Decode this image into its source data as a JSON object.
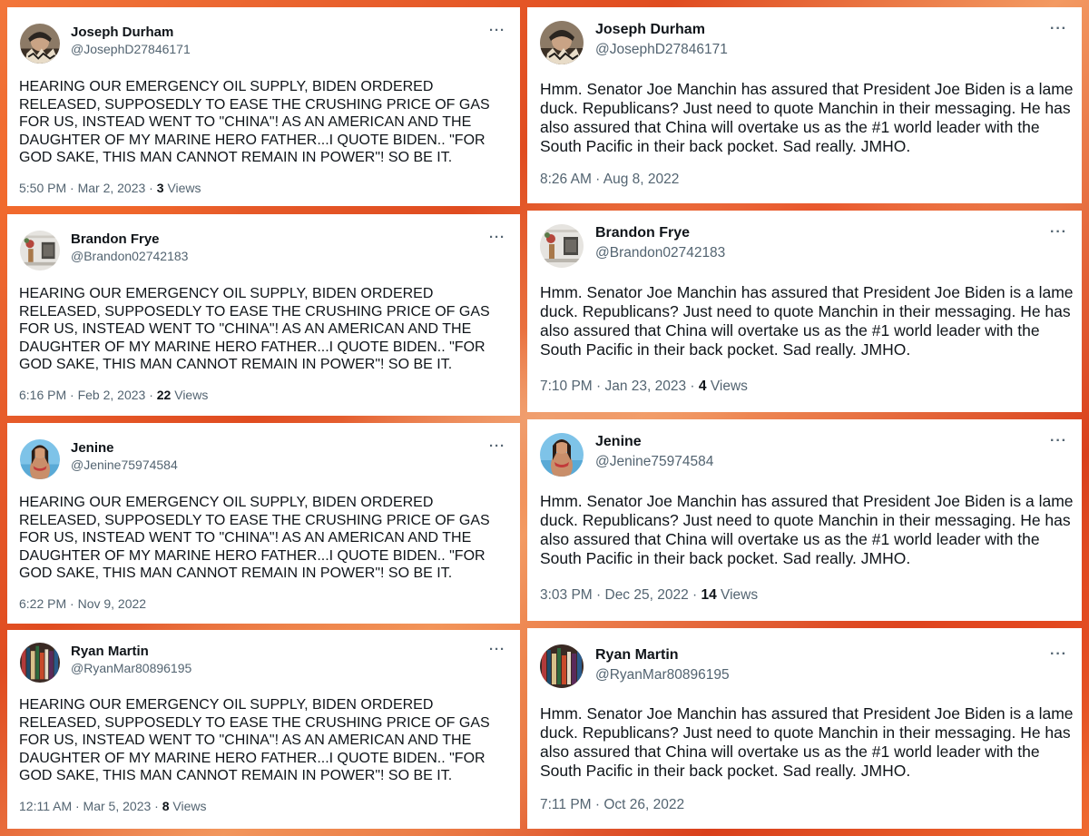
{
  "left_tweets": [
    {
      "name": "Joseph Durham",
      "handle": "@JosephD27846171",
      "text": "HEARING OUR EMERGENCY OIL SUPPLY, BIDEN ORDERED RELEASED, SUPPOSEDLY TO EASE THE CRUSHING PRICE OF GAS FOR US, INSTEAD WENT TO \"CHINA\"!  AS AN AMERICAN AND THE DAUGHTER OF MY MARINE HERO FATHER...I  QUOTE BIDEN.. \"FOR GOD SAKE, THIS MAN CANNOT REMAIN IN POWER\"! SO BE IT.",
      "timestamp": "5:50 PM · Mar 2, 2023",
      "views_count": "3",
      "views_label": "Views",
      "more": "···"
    },
    {
      "name": "Brandon Frye",
      "handle": "@Brandon02742183",
      "text": "HEARING OUR EMERGENCY OIL SUPPLY, BIDEN ORDERED RELEASED, SUPPOSEDLY TO EASE THE CRUSHING PRICE OF GAS FOR US, INSTEAD WENT TO \"CHINA\"!  AS AN AMERICAN AND THE DAUGHTER OF MY MARINE HERO FATHER...I  QUOTE BIDEN.. \"FOR GOD SAKE, THIS MAN CANNOT REMAIN IN POWER\"! SO BE IT.",
      "timestamp": "6:16 PM · Feb 2, 2023",
      "views_count": "22",
      "views_label": "Views",
      "more": "···"
    },
    {
      "name": "Jenine",
      "handle": "@Jenine75974584",
      "text": "HEARING OUR EMERGENCY OIL SUPPLY, BIDEN ORDERED RELEASED, SUPPOSEDLY TO EASE THE CRUSHING PRICE OF GAS FOR US, INSTEAD WENT TO \"CHINA\"!  AS AN AMERICAN AND THE DAUGHTER OF MY MARINE HERO FATHER...I  QUOTE BIDEN.. \"FOR GOD SAKE, THIS MAN CANNOT REMAIN IN POWER\"! SO BE IT.",
      "timestamp": "6:22 PM · Nov 9, 2022",
      "views_count": "",
      "views_label": "",
      "more": "···"
    },
    {
      "name": "Ryan Martin",
      "handle": "@RyanMar80896195",
      "text": "HEARING OUR EMERGENCY OIL SUPPLY, BIDEN ORDERED RELEASED, SUPPOSEDLY TO EASE THE CRUSHING PRICE OF GAS FOR US, INSTEAD WENT TO \"CHINA\"!  AS AN AMERICAN AND THE DAUGHTER OF MY MARINE HERO FATHER...I  QUOTE BIDEN.. \"FOR GOD SAKE, THIS MAN CANNOT REMAIN IN POWER\"! SO BE IT.",
      "timestamp": "12:11 AM · Mar 5, 2023",
      "views_count": "8",
      "views_label": "Views",
      "more": "···"
    }
  ],
  "right_tweets": [
    {
      "name": "Joseph Durham",
      "handle": "@JosephD27846171",
      "text": "Hmm. Senator Joe Manchin has assured that President Joe Biden is a lame duck. Republicans? Just need to quote Manchin in their messaging. He has also assured that China will overtake us as the #1 world leader with the South Pacific in their back pocket. Sad really. JMHO.",
      "timestamp": "8:26 AM · Aug 8, 2022",
      "views_count": "",
      "views_label": "",
      "more": "···"
    },
    {
      "name": "Brandon Frye",
      "handle": "@Brandon02742183",
      "text": "Hmm. Senator Joe Manchin has assured that President Joe Biden is a lame duck. Republicans? Just need to quote Manchin in their messaging. He has also assured that China will overtake us as the #1 world leader with the South Pacific in their back pocket. Sad really. JMHO.",
      "timestamp": "7:10 PM · Jan 23, 2023 · ",
      "views_count": "4",
      "views_label": "Views",
      "more": "···"
    },
    {
      "name": "Jenine",
      "handle": "@Jenine75974584",
      "text": "Hmm. Senator Joe Manchin has assured that President Joe Biden is a lame duck. Republicans? Just need to quote Manchin in their messaging. He has also assured that China will overtake us as the #1 world leader with the South Pacific in their back pocket. Sad really. JMHO.",
      "timestamp": "3:03 PM · Dec 25, 2022 · ",
      "views_count": "14",
      "views_label": "Views",
      "more": "···"
    },
    {
      "name": "Ryan Martin",
      "handle": "@RyanMar80896195",
      "text": "Hmm. Senator Joe Manchin has assured that President Joe Biden is a lame duck. Republicans? Just need to quote Manchin in their messaging. He has also assured that China will overtake us as the #1 world leader with the South Pacific in their back pocket. Sad really. JMHO.",
      "timestamp": "7:11 PM · Oct 26, 2022",
      "views_count": "",
      "views_label": "",
      "more": "···"
    }
  ]
}
